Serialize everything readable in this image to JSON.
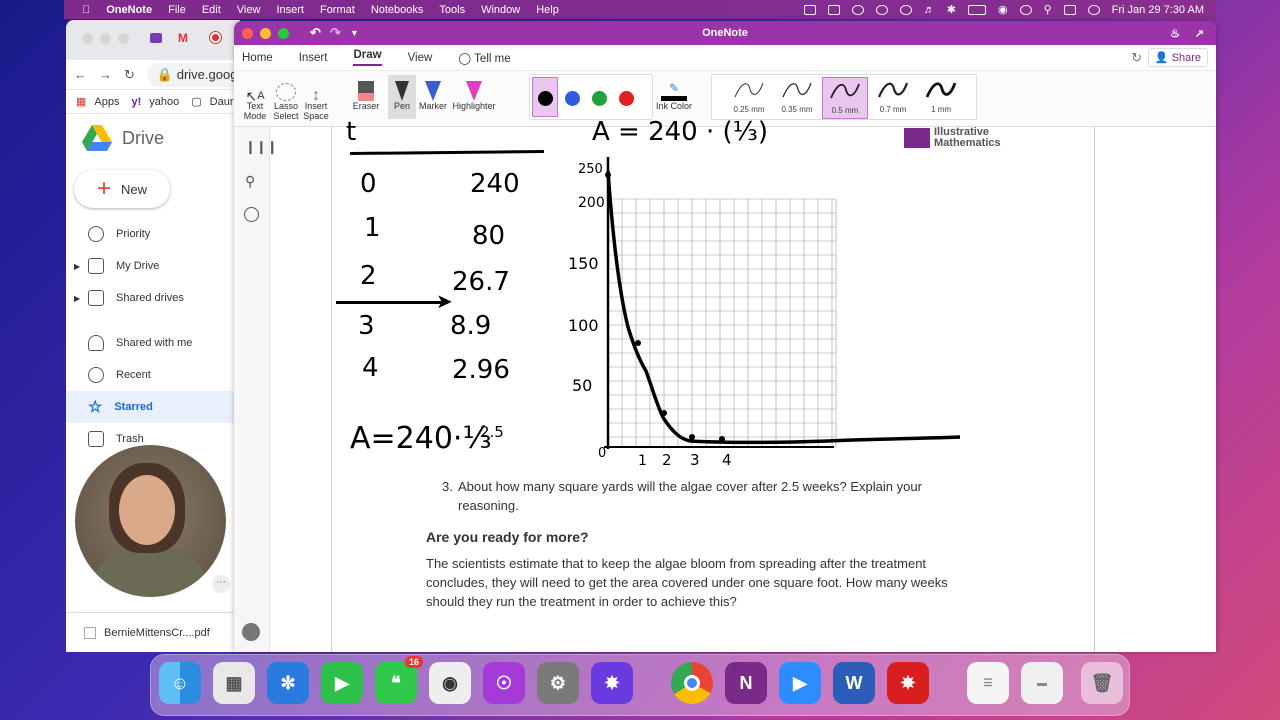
{
  "menubar": {
    "app_name": "OneNote",
    "items": [
      "File",
      "Edit",
      "View",
      "Insert",
      "Format",
      "Notebooks",
      "Tools",
      "Window",
      "Help"
    ],
    "clock": "Fri Jan 29  7:30 AM"
  },
  "chrome": {
    "url": "drive.goog",
    "bookmarks": [
      "Apps",
      "yahoo",
      "Daur"
    ],
    "drive_title": "Drive",
    "new_label": "New",
    "nav": [
      {
        "label": "Priority",
        "icon": "priority-icon"
      },
      {
        "label": "My Drive",
        "icon": "my-drive-icon"
      },
      {
        "label": "Shared drives",
        "icon": "shared-drives-icon"
      },
      {
        "label": "Shared with me",
        "icon": "shared-with-me-icon"
      },
      {
        "label": "Recent",
        "icon": "recent-icon"
      },
      {
        "label": "Starred",
        "icon": "star-icon"
      },
      {
        "label": "Trash",
        "icon": "trash-icon"
      }
    ],
    "download_name": "BernieMittensCr....pdf"
  },
  "onenote": {
    "window_title": "OneNote",
    "tabs": [
      "Home",
      "Insert",
      "Draw",
      "View",
      "Tell me"
    ],
    "active_tab": "Draw",
    "share_label": "Share",
    "tools": {
      "text_mode": "Text Mode",
      "lasso_select": "Lasso Select",
      "insert_space": "Insert Space",
      "eraser": "Eraser",
      "pen": "Pen",
      "marker": "Marker",
      "highlighter": "Highlighter",
      "ink_color": "Ink Color"
    },
    "pen_colors": [
      "#000000",
      "#2f5be0",
      "#20a33a",
      "#e02020"
    ],
    "thicknesses": [
      "0.25 mm",
      "0.35 mm",
      "0.5 mm",
      "0.7 mm",
      "1 mm"
    ],
    "selected_thickness": "0.5 mm",
    "logo_text": "Illustrative Mathematics",
    "table": {
      "rows": [
        [
          "0",
          "240"
        ],
        [
          "1",
          "80"
        ],
        [
          "2",
          "26.7"
        ],
        [
          "3",
          "8.9"
        ],
        [
          "4",
          "2.96"
        ]
      ]
    },
    "formula_top": "A = 240 · (⅓)",
    "formula_bottom_base": "A=240·⅓",
    "formula_bottom_exp": "2.5",
    "graph": {
      "y_ticks": [
        "250",
        "200",
        "150",
        "100",
        "50",
        "0"
      ],
      "x_ticks": [
        "1",
        "2",
        "3",
        "4"
      ]
    },
    "question_3_num": "3.",
    "question_3": "About how many square yards will the algae cover after 2.5 weeks? Explain your reasoning.",
    "more_heading": "Are you ready for more?",
    "more_text": "The scientists estimate that to keep the algae bloom from spreading after the treatment concludes, they will need to get the area covered under one square foot. How many weeks should they run the treatment in order to achieve this?"
  },
  "dock": {
    "messages_badge": "16",
    "apps": [
      "finder-icon",
      "launchpad-icon",
      "safari-icon",
      "facetime-icon",
      "messages-icon",
      "screenshot-icon",
      "podcasts-icon",
      "system-preferences-icon",
      "photo-icon",
      "chrome-icon",
      "onenote-icon",
      "zoom-icon",
      "word-icon",
      "acrobat-icon",
      "document-preview-icon",
      "chrome-doc-icon",
      "trash-icon"
    ]
  }
}
